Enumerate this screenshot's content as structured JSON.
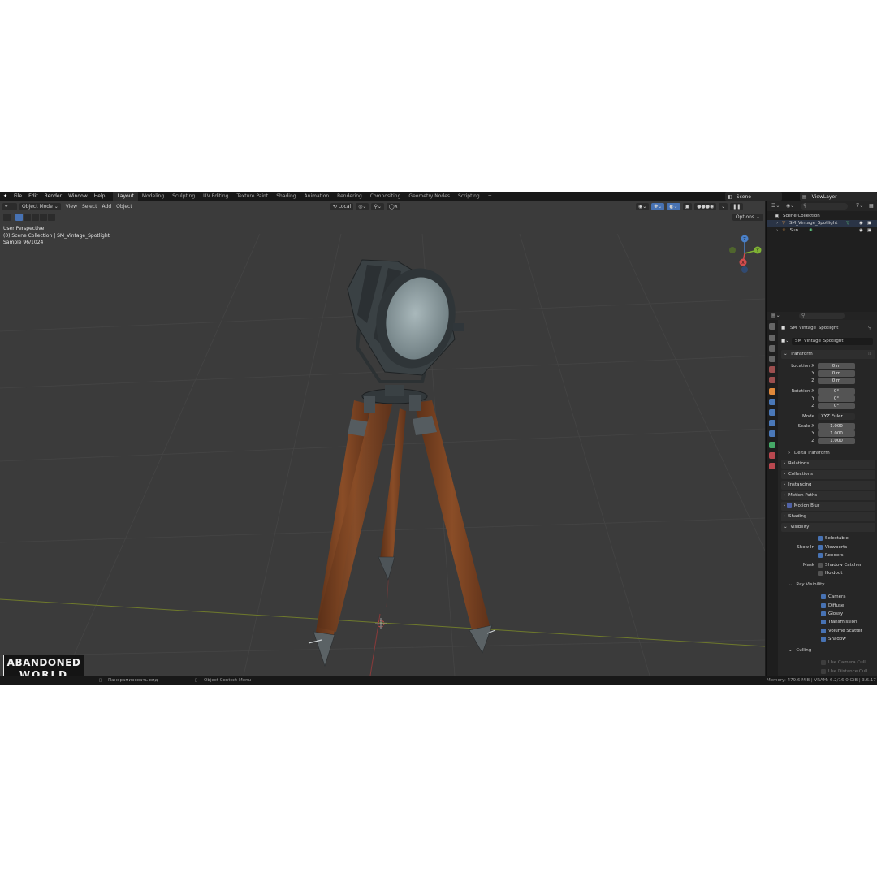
{
  "topbar": {
    "menus": [
      "File",
      "Edit",
      "Render",
      "Window",
      "Help"
    ],
    "workspaces": [
      "Layout",
      "Modeling",
      "Sculpting",
      "UV Editing",
      "Texture Paint",
      "Shading",
      "Animation",
      "Rendering",
      "Compositing",
      "Geometry Nodes",
      "Scripting"
    ],
    "active_workspace": "Layout",
    "add_tab": "+",
    "scene": "Scene",
    "view_layer": "ViewLayer"
  },
  "viewport": {
    "mode": "Object Mode",
    "menus": [
      "View",
      "Select",
      "Add",
      "Object"
    ],
    "transform_orientation": "Local",
    "options": "Options",
    "overlay": {
      "line1": "User Perspective",
      "line2": "(0) Scene Collection | SM_Vintage_Spotlight",
      "line3": "Sample 96/1024"
    },
    "gizmo": {
      "z": "Z",
      "y": "Y",
      "x": "X"
    },
    "logo": {
      "line1": "ABANDONED",
      "line2": "WORLD"
    }
  },
  "outliner": {
    "root": "Scene Collection",
    "items": [
      "SM_Vintage_Spotlight",
      "Sun"
    ]
  },
  "properties": {
    "object_name": "SM_Vintage_Spotlight",
    "data_name": "SM_Vintage_Spotlight",
    "transform": {
      "title": "Transform",
      "location_label": "Location X",
      "location": [
        "0 m",
        "0 m",
        "0 m"
      ],
      "rotation_label": "Rotation X",
      "rotation": [
        "0°",
        "0°",
        "0°"
      ],
      "y": "Y",
      "z": "Z",
      "mode_label": "Mode",
      "mode": "XYZ Euler",
      "scale_label": "Scale X",
      "scale": [
        "1.000",
        "1.000",
        "1.000"
      ],
      "delta": "Delta Transform"
    },
    "sections": [
      "Relations",
      "Collections",
      "Instancing",
      "Motion Paths",
      "Motion Blur",
      "Shading"
    ],
    "visibility": {
      "title": "Visibility",
      "selectable": "Selectable",
      "show_in": "Show In",
      "viewports": "Viewports",
      "renders": "Renders",
      "mask": "Mask",
      "shadow_catcher": "Shadow Catcher",
      "holdout": "Holdout",
      "ray_title": "Ray Visibility",
      "rays": [
        "Camera",
        "Diffuse",
        "Glossy",
        "Transmission",
        "Volume Scatter",
        "Shadow"
      ],
      "culling": "Culling",
      "camera_cull": "Use Camera Cull",
      "distance_cull": "Use Distance Cull"
    }
  },
  "statusbar": {
    "left": "Панорамировать вид",
    "middle": "Object Context Menu",
    "right": "Memory: 479.6 MiB | VRAM: 6.2/16.0 GiB | 3.6.17"
  },
  "colors": {
    "accent": "#4772b3",
    "wood": "#7a4322",
    "metal": "#4a5257",
    "lens": "#8fa0a4"
  }
}
